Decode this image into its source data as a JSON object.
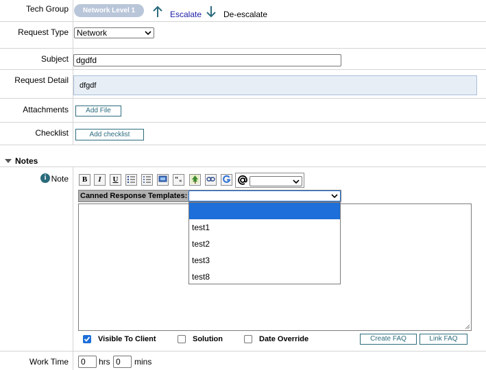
{
  "tech_group": {
    "label": "Tech Group",
    "pill": "Network  Level 1",
    "escalate": "Escalate",
    "deescalate": "De-escalate"
  },
  "request_type": {
    "label": "Request Type",
    "value": "Network"
  },
  "subject": {
    "label": "Subject",
    "value": "dgdfd"
  },
  "request_detail": {
    "label": "Request Detail",
    "value": "dfgdf"
  },
  "attachments": {
    "label": "Attachments",
    "button": "Add File"
  },
  "checklist": {
    "label": "Checklist",
    "button": "Add checklist"
  },
  "notes": {
    "section_title": "Notes",
    "note_label": "Note",
    "toolbar": [
      "B",
      "I",
      "U"
    ],
    "canned_label": "Canned Response Templates:",
    "canned_options": [
      "",
      "test1",
      "test2",
      "test3",
      "test8"
    ],
    "visible_to_client": "Visible To Client",
    "solution": "Solution",
    "date_override": "Date Override",
    "create_faq": "Create FAQ",
    "link_faq": "Link FAQ"
  },
  "work_time": {
    "label": "Work Time",
    "hrs_value": "0",
    "hrs_unit": "hrs",
    "mins_value": "0",
    "mins_unit": "mins"
  },
  "colors": {
    "accent": "#2a6b7c",
    "pill": "#b9c6d9",
    "selection": "#1e6fd9"
  }
}
